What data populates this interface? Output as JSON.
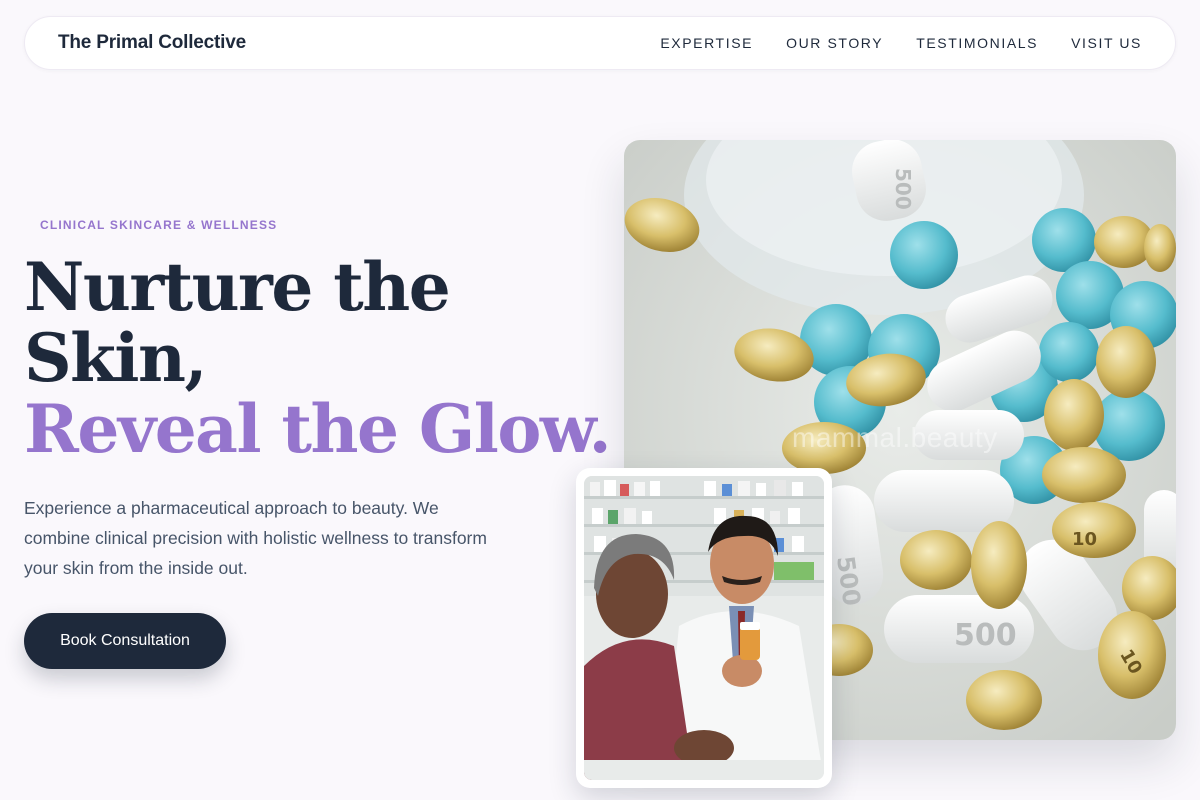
{
  "nav": {
    "brand": "The Primal Collective",
    "links": [
      "EXPERTISE",
      "OUR STORY",
      "TESTIMONIALS",
      "VISIT US"
    ]
  },
  "hero": {
    "eyebrow": "CLINICAL SKINCARE & WELLNESS",
    "headline_1": "Nurture the",
    "headline_2": "Skin,",
    "headline_accent": "Reveal the Glow.",
    "lead": "Experience a pharmaceutical approach to beauty. We combine clinical precision with holistic wellness to transform your skin from the inside out.",
    "cta": "Book Consultation"
  },
  "images": {
    "main_watermark": "mammal.beauty",
    "pill_markings": [
      "500",
      "500",
      "10",
      "10",
      "500"
    ]
  },
  "colors": {
    "accent": "#9575cd",
    "ink": "#1e293b",
    "muted": "#475569",
    "background": "#faf8fc"
  }
}
